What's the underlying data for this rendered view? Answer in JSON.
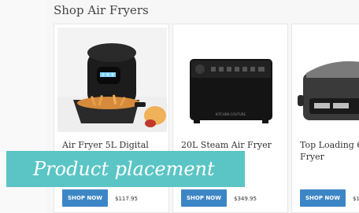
{
  "section": {
    "title": "Shop Air Fryers"
  },
  "products": [
    {
      "name": "Air Fryer 5L Digital",
      "button": "SHOP NOW",
      "price": "$117.95"
    },
    {
      "name": "20L Steam Air Fryer",
      "button": "SHOP NOW",
      "price": "$349.95"
    },
    {
      "name": "Top Loading 6\nFryer",
      "button": "SHOP NOW",
      "price": "$1"
    }
  ],
  "display": {
    "lcd_text": "2 0 0",
    "brand": "KITCHEN COUTURE"
  },
  "banner": {
    "text": "Product placement"
  },
  "colors": {
    "button": "#3d86c6",
    "banner": "#5bc5c5"
  }
}
